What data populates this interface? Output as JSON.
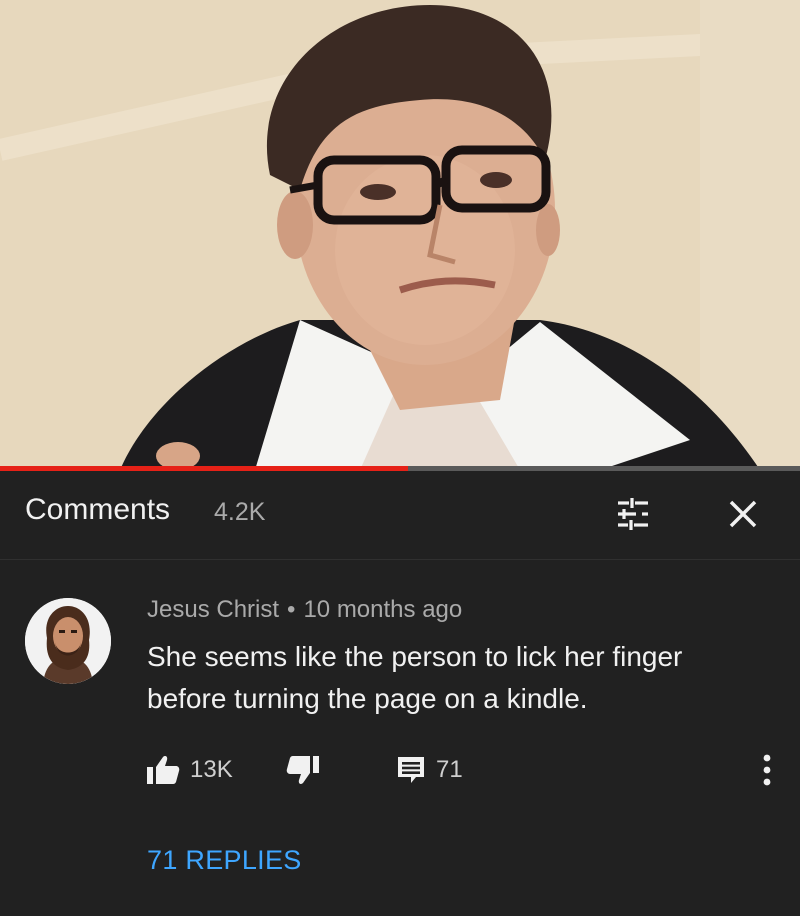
{
  "video": {
    "progress_fraction": 0.51,
    "progress_color": "#e62117"
  },
  "comments_header": {
    "title": "Comments",
    "count": "4.2K",
    "filter_icon": "sort-filter-icon",
    "close_icon": "close-icon"
  },
  "comment": {
    "author": "Jesus Christ",
    "separator": "•",
    "time": "10 months ago",
    "text": "She seems like the person to lick her finger before turning the page on a kindle.",
    "likes": "13K",
    "replies_count": "71",
    "replies_label": "71 REPLIES",
    "icons": {
      "like": "thumbs-up-icon",
      "dislike": "thumbs-down-icon",
      "reply": "reply-comment-icon",
      "more": "more-vertical-icon"
    }
  },
  "colors": {
    "background": "#212121",
    "link": "#3ea6ff",
    "secondary_text": "#aaaaaa"
  }
}
